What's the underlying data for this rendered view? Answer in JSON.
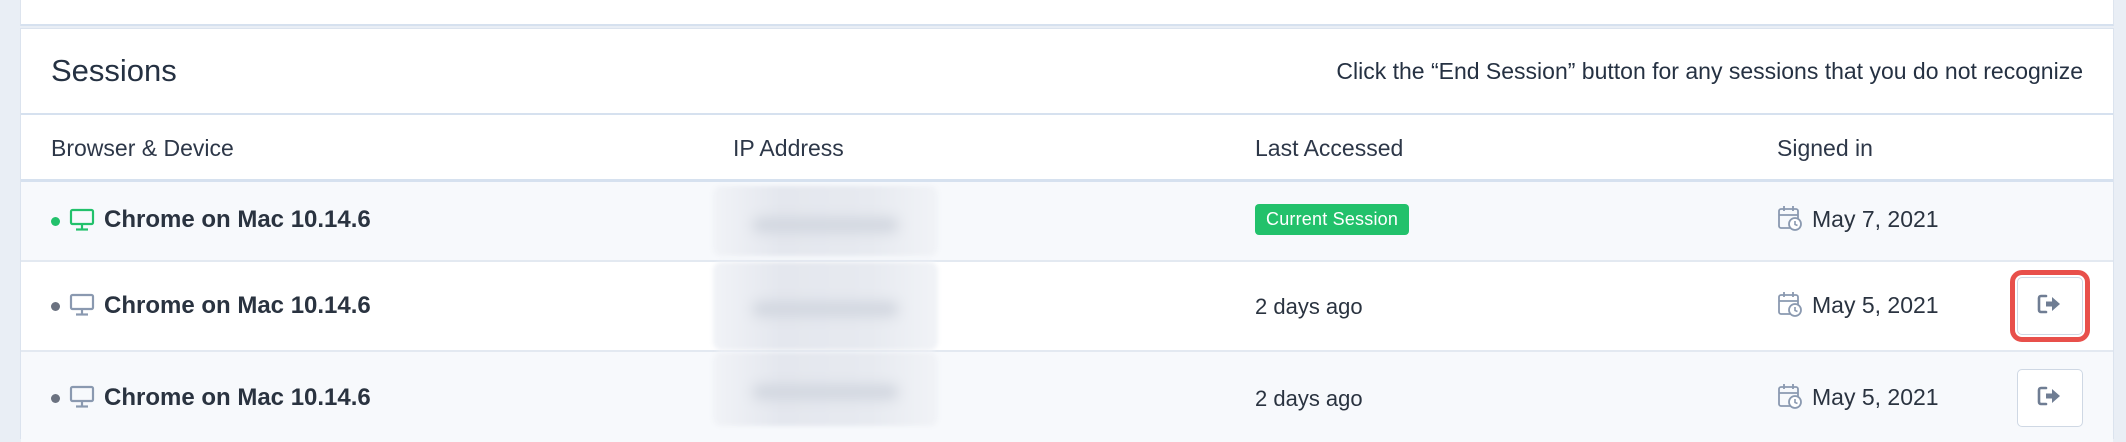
{
  "card": {
    "title": "Sessions",
    "hint": "Click the “End Session” button for any sessions that you do not recognize"
  },
  "columns": {
    "device": "Browser & Device",
    "ip": "IP Address",
    "last_accessed": "Last Accessed",
    "signed_in": "Signed in"
  },
  "sessions": [
    {
      "status": "active",
      "device": "Chrome on Mac 10.14.6",
      "ip": "",
      "last_accessed": "Current Session",
      "signed_in": "May 7, 2021",
      "icons": [
        "status-dot",
        "desktop-icon",
        "calendar-clock-icon"
      ]
    },
    {
      "status": "inactive",
      "device": "Chrome on Mac 10.14.6",
      "ip": "",
      "last_accessed": "2 days ago",
      "signed_in": "May 5, 2021",
      "end_session_icon": "sign-out-icon",
      "highlighted": true
    },
    {
      "status": "inactive",
      "device": "Chrome on Mac 10.14.6",
      "ip": "",
      "last_accessed": "2 days ago",
      "signed_in": "May 5, 2021",
      "end_session_icon": "sign-out-icon"
    }
  ],
  "colors": {
    "active": "#22c16b",
    "inactive": "#6b7280",
    "highlight": "#e8504b",
    "icon": "#8a99b0"
  }
}
